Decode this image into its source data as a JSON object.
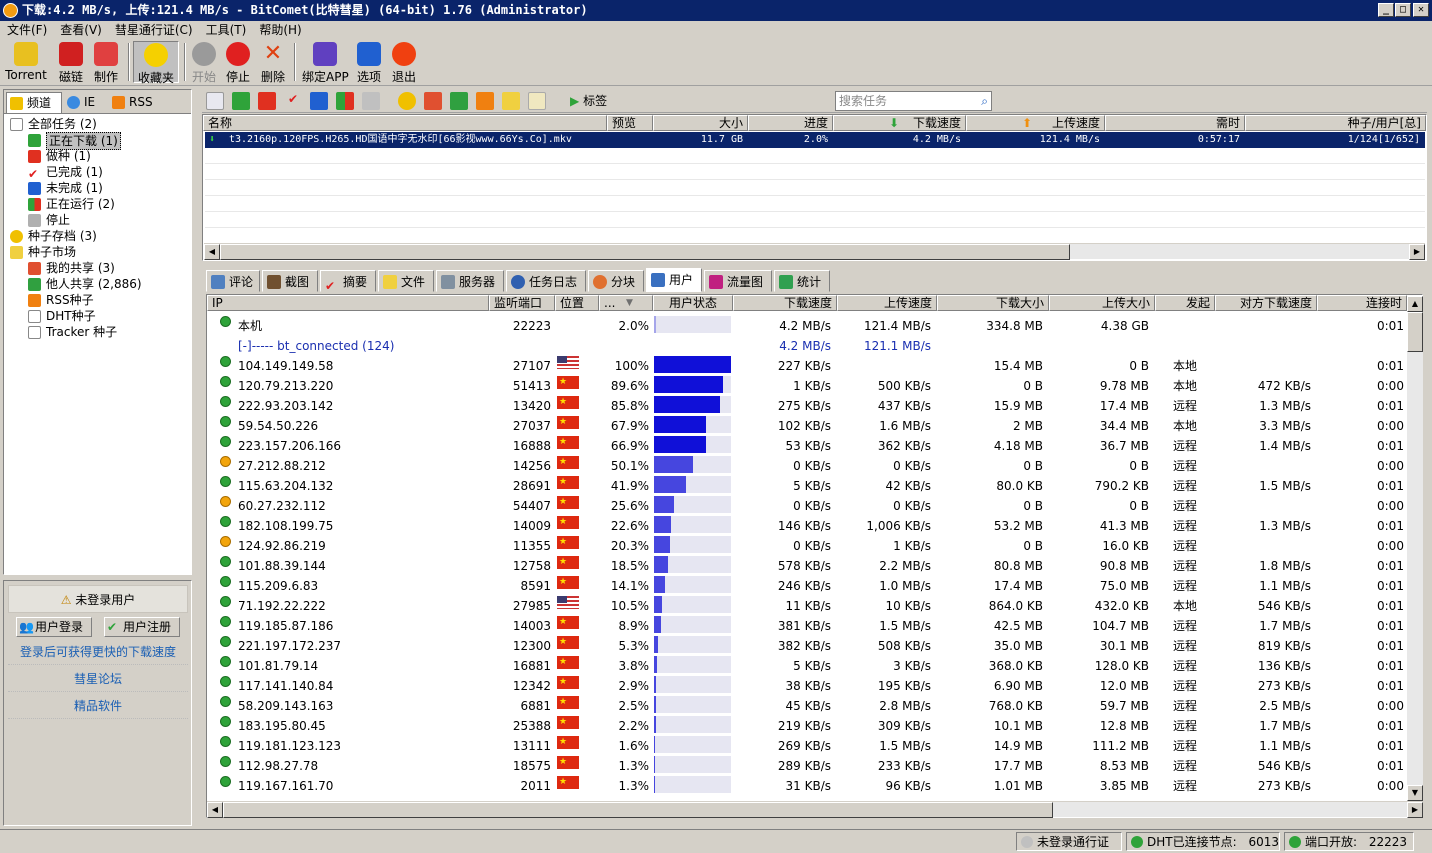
{
  "window": {
    "title": "下载:4.2 MB/s, 上传:121.4 MB/s - BitComet(比特彗星) (64-bit) 1.76 (Administrator)",
    "min": "_",
    "max": "□",
    "close": "✕"
  },
  "menu": [
    "文件(F)",
    "查看(V)",
    "彗星通行证(C)",
    "工具(T)",
    "帮助(H)"
  ],
  "toolbar": [
    {
      "label": "Torrent",
      "icon": "torrent-icon"
    },
    {
      "label": "磁链",
      "icon": "magnet-icon"
    },
    {
      "label": "制作",
      "icon": "make-icon"
    },
    {
      "label": "收藏夹",
      "icon": "star-icon"
    },
    {
      "label": "开始",
      "icon": "play-icon"
    },
    {
      "label": "停止",
      "icon": "stop-icon"
    },
    {
      "label": "删除",
      "icon": "delete-icon"
    },
    {
      "label": "绑定APP",
      "icon": "bind-app-icon"
    },
    {
      "label": "选项",
      "icon": "options-icon"
    },
    {
      "label": "退出",
      "icon": "exit-icon"
    }
  ],
  "left_tabs": [
    "频道",
    "IE",
    "RSS"
  ],
  "tree": [
    {
      "label": "全部任务",
      "count": "(2)"
    },
    {
      "label": "正在下载",
      "count": "(1)"
    },
    {
      "label": "做种",
      "count": "(1)"
    },
    {
      "label": "已完成",
      "count": "(1)"
    },
    {
      "label": "未完成",
      "count": "(1)"
    },
    {
      "label": "正在运行",
      "count": "(2)"
    },
    {
      "label": "停止",
      "count": ""
    },
    {
      "label": "种子存档",
      "count": "(3)"
    },
    {
      "label": "种子市场",
      "count": ""
    },
    {
      "label": "我的共享",
      "count": "(3)"
    },
    {
      "label": "他人共享",
      "count": "(2,886)"
    },
    {
      "label": "RSS种子",
      "count": ""
    },
    {
      "label": "DHT种子",
      "count": ""
    },
    {
      "label": "Tracker 种子",
      "count": ""
    }
  ],
  "login": {
    "header": "未登录用户",
    "login_btn": "用户登录",
    "register_btn": "用户注册",
    "links": [
      "登录后可获得更快的下载速度",
      "彗星论坛",
      "精品软件"
    ]
  },
  "task_toolbar": {
    "tag_label": "标签",
    "search_placeholder": "搜索任务"
  },
  "task_columns": [
    "名称",
    "预览",
    "大小",
    "进度",
    "下载速度",
    "上传速度",
    "需时",
    "种子/用户[总]"
  ],
  "task": {
    "name": "t3.2160p.120FPS.H265.HD国语中字无水印[66影视www.66Ys.Co].mkv",
    "preview": "",
    "size": "11.7 GB",
    "progress": "2.0%",
    "down": "4.2 MB/s",
    "up": "121.4 MB/s",
    "eta": "0:57:17",
    "seeds": "1/124[1/652]"
  },
  "peer_tabs": [
    "评论",
    "截图",
    "摘要",
    "文件",
    "服务器",
    "任务日志",
    "分块",
    "用户",
    "流量图",
    "统计"
  ],
  "peer_columns": [
    "IP",
    "监听端口",
    "位置",
    "...",
    "用户状态",
    "下载速度",
    "上传速度",
    "下载大小",
    "上传大小",
    "发起",
    "对方下载速度",
    "连接时"
  ],
  "local": {
    "ip": "本机",
    "port": "22223",
    "pct": "2.0%",
    "down": "4.2 MB/s",
    "up": "121.4 MB/s",
    "dsize": "334.8 MB",
    "usize": "4.38 GB",
    "conn": "0:01"
  },
  "group": {
    "label": "[-]----- bt_connected (124)",
    "down": "4.2 MB/s",
    "up": "121.1 MB/s"
  },
  "peers": [
    {
      "ip": "104.149.149.58",
      "port": "27107",
      "flag": "us",
      "pct": "100%",
      "p": 1.0,
      "down": "227 KB/s",
      "up": "",
      "dsize": "15.4 MB",
      "usize": "0 B",
      "init": "本地",
      "rdown": "",
      "conn": "0:01",
      "st": "g"
    },
    {
      "ip": "120.79.213.220",
      "port": "51413",
      "flag": "cn",
      "pct": "89.6%",
      "p": 0.896,
      "down": "1 KB/s",
      "up": "500 KB/s",
      "dsize": "0 B",
      "usize": "9.78 MB",
      "init": "本地",
      "rdown": "472 KB/s",
      "conn": "0:00",
      "st": "g"
    },
    {
      "ip": "222.93.203.142",
      "port": "13420",
      "flag": "cn",
      "pct": "85.8%",
      "p": 0.858,
      "down": "275 KB/s",
      "up": "437 KB/s",
      "dsize": "15.9 MB",
      "usize": "17.4 MB",
      "init": "远程",
      "rdown": "1.3 MB/s",
      "conn": "0:01",
      "st": "g"
    },
    {
      "ip": "59.54.50.226",
      "port": "27037",
      "flag": "cn",
      "pct": "67.9%",
      "p": 0.679,
      "down": "102 KB/s",
      "up": "1.6 MB/s",
      "dsize": "2 MB",
      "usize": "34.4 MB",
      "init": "本地",
      "rdown": "3.3 MB/s",
      "conn": "0:00",
      "st": "g"
    },
    {
      "ip": "223.157.206.166",
      "port": "16888",
      "flag": "cn",
      "pct": "66.9%",
      "p": 0.669,
      "down": "53 KB/s",
      "up": "362 KB/s",
      "dsize": "4.18 MB",
      "usize": "36.7 MB",
      "init": "远程",
      "rdown": "1.4 MB/s",
      "conn": "0:01",
      "st": "g"
    },
    {
      "ip": "27.212.88.212",
      "port": "14256",
      "flag": "cn",
      "pct": "50.1%",
      "p": 0.501,
      "down": "0 KB/s",
      "up": "0 KB/s",
      "dsize": "0 B",
      "usize": "0 B",
      "init": "远程",
      "rdown": "",
      "conn": "0:00",
      "st": "y"
    },
    {
      "ip": "115.63.204.132",
      "port": "28691",
      "flag": "cn",
      "pct": "41.9%",
      "p": 0.419,
      "down": "5 KB/s",
      "up": "42 KB/s",
      "dsize": "80.0 KB",
      "usize": "790.2 KB",
      "init": "远程",
      "rdown": "1.5 MB/s",
      "conn": "0:01",
      "st": "g"
    },
    {
      "ip": "60.27.232.112",
      "port": "54407",
      "flag": "cn",
      "pct": "25.6%",
      "p": 0.256,
      "down": "0 KB/s",
      "up": "0 KB/s",
      "dsize": "0 B",
      "usize": "0 B",
      "init": "远程",
      "rdown": "",
      "conn": "0:00",
      "st": "y"
    },
    {
      "ip": "182.108.199.75",
      "port": "14009",
      "flag": "cn",
      "pct": "22.6%",
      "p": 0.226,
      "down": "146 KB/s",
      "up": "1,006 KB/s",
      "dsize": "53.2 MB",
      "usize": "41.3 MB",
      "init": "远程",
      "rdown": "1.3 MB/s",
      "conn": "0:01",
      "st": "g"
    },
    {
      "ip": "124.92.86.219",
      "port": "11355",
      "flag": "cn",
      "pct": "20.3%",
      "p": 0.203,
      "down": "0 KB/s",
      "up": "1 KB/s",
      "dsize": "0 B",
      "usize": "16.0 KB",
      "init": "远程",
      "rdown": "",
      "conn": "0:00",
      "st": "y"
    },
    {
      "ip": "101.88.39.144",
      "port": "12758",
      "flag": "cn",
      "pct": "18.5%",
      "p": 0.185,
      "down": "578 KB/s",
      "up": "2.2 MB/s",
      "dsize": "80.8 MB",
      "usize": "90.8 MB",
      "init": "远程",
      "rdown": "1.8 MB/s",
      "conn": "0:01",
      "st": "g"
    },
    {
      "ip": "115.209.6.83",
      "port": "8591",
      "flag": "cn",
      "pct": "14.1%",
      "p": 0.141,
      "down": "246 KB/s",
      "up": "1.0 MB/s",
      "dsize": "17.4 MB",
      "usize": "75.0 MB",
      "init": "远程",
      "rdown": "1.1 MB/s",
      "conn": "0:01",
      "st": "g"
    },
    {
      "ip": "71.192.22.222",
      "port": "27985",
      "flag": "us",
      "pct": "10.5%",
      "p": 0.105,
      "down": "11 KB/s",
      "up": "10 KB/s",
      "dsize": "864.0 KB",
      "usize": "432.0 KB",
      "init": "本地",
      "rdown": "546 KB/s",
      "conn": "0:01",
      "st": "g"
    },
    {
      "ip": "119.185.87.186",
      "port": "14003",
      "flag": "cn",
      "pct": "8.9%",
      "p": 0.089,
      "down": "381 KB/s",
      "up": "1.5 MB/s",
      "dsize": "42.5 MB",
      "usize": "104.7 MB",
      "init": "远程",
      "rdown": "1.7 MB/s",
      "conn": "0:01",
      "st": "g"
    },
    {
      "ip": "221.197.172.237",
      "port": "12300",
      "flag": "cn",
      "pct": "5.3%",
      "p": 0.053,
      "down": "382 KB/s",
      "up": "508 KB/s",
      "dsize": "35.0 MB",
      "usize": "30.1 MB",
      "init": "远程",
      "rdown": "819 KB/s",
      "conn": "0:01",
      "st": "g"
    },
    {
      "ip": "101.81.79.14",
      "port": "16881",
      "flag": "cn",
      "pct": "3.8%",
      "p": 0.038,
      "down": "5 KB/s",
      "up": "3 KB/s",
      "dsize": "368.0 KB",
      "usize": "128.0 KB",
      "init": "远程",
      "rdown": "136 KB/s",
      "conn": "0:01",
      "st": "g"
    },
    {
      "ip": "117.141.140.84",
      "port": "12342",
      "flag": "cn",
      "pct": "2.9%",
      "p": 0.029,
      "down": "38 KB/s",
      "up": "195 KB/s",
      "dsize": "6.90 MB",
      "usize": "12.0 MB",
      "init": "远程",
      "rdown": "273 KB/s",
      "conn": "0:01",
      "st": "g"
    },
    {
      "ip": "58.209.143.163",
      "port": "6881",
      "flag": "cn",
      "pct": "2.5%",
      "p": 0.025,
      "down": "45 KB/s",
      "up": "2.8 MB/s",
      "dsize": "768.0 KB",
      "usize": "59.7 MB",
      "init": "远程",
      "rdown": "2.5 MB/s",
      "conn": "0:00",
      "st": "g"
    },
    {
      "ip": "183.195.80.45",
      "port": "25388",
      "flag": "cn",
      "pct": "2.2%",
      "p": 0.022,
      "down": "219 KB/s",
      "up": "309 KB/s",
      "dsize": "10.1 MB",
      "usize": "12.8 MB",
      "init": "远程",
      "rdown": "1.7 MB/s",
      "conn": "0:01",
      "st": "g"
    },
    {
      "ip": "119.181.123.123",
      "port": "13111",
      "flag": "cn",
      "pct": "1.6%",
      "p": 0.016,
      "down": "269 KB/s",
      "up": "1.5 MB/s",
      "dsize": "14.9 MB",
      "usize": "111.2 MB",
      "init": "远程",
      "rdown": "1.1 MB/s",
      "conn": "0:01",
      "st": "g"
    },
    {
      "ip": "112.98.27.78",
      "port": "18575",
      "flag": "cn",
      "pct": "1.3%",
      "p": 0.013,
      "down": "289 KB/s",
      "up": "233 KB/s",
      "dsize": "17.7 MB",
      "usize": "8.53 MB",
      "init": "远程",
      "rdown": "546 KB/s",
      "conn": "0:01",
      "st": "g"
    },
    {
      "ip": "119.167.161.70",
      "port": "2011",
      "flag": "cn",
      "pct": "1.3%",
      "p": 0.013,
      "down": "31 KB/s",
      "up": "96 KB/s",
      "dsize": "1.01 MB",
      "usize": "3.85 MB",
      "init": "远程",
      "rdown": "273 KB/s",
      "conn": "0:00",
      "st": "g"
    }
  ],
  "status": {
    "passport": "未登录通行证",
    "dht_label": "DHT已连接节点:",
    "dht_value": "6013",
    "port_label": "端口开放:",
    "port_value": "22223"
  },
  "colors": {
    "selection": "#0a246a",
    "bar": "#1010d8",
    "green": "#2fa33a"
  }
}
